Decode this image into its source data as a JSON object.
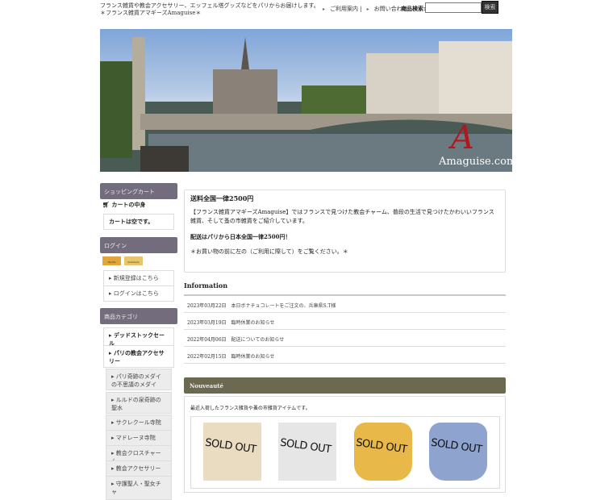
{
  "header": {
    "tagline": "フランス雑貨や教会アクセサリー、エッフェル塔グッズなどをパリからお届けします。",
    "shop_name": "＊フランス雑貨アマギーズAmaguise＊",
    "links": [
      "ご利用案内 |",
      "お問い合わせ"
    ],
    "search_label": "商品検索:",
    "search_value": "",
    "search_button": "検索"
  },
  "banner": {
    "logo_text": "Amaguise.com"
  },
  "sidebar": {
    "cart": {
      "title": "ショッピングカート",
      "contents_label": "カートの中身",
      "empty_text": "カートは空です。"
    },
    "login": {
      "title": "ログイン",
      "badges": [
        "PayPal",
        "members"
      ],
      "register": "新規登録はこちら",
      "login": "ログインはこちら"
    },
    "categories": {
      "title": "商品カテゴリ",
      "items": [
        "デッドストックセール",
        "パリの教会アクセサリー"
      ],
      "subitems": [
        "パリ奇跡のメダイの不思議のメダイ",
        "ルルドの泉奇跡の聖水",
        "サクレクール寺院",
        "マドレーヌ寺院",
        "教会クロスチャーム",
        "教会アクセサリー",
        "守護聖人・聖女チャ"
      ]
    }
  },
  "main": {
    "notice": {
      "title": "送料全国一律2500円",
      "body": "【フランス雑貨アマギーズAmaguise】ではフランスで見つけた教会チャーム、普段の生活で見つけたかわいいフランス雑貨、そして蚤の市雑貨をご紹介しています。",
      "shipping": "配送はパリから日本全国一律2500円！",
      "note": "＊お買い物の前に左の（ご利用に際して）をご覧ください。＊"
    },
    "information": {
      "title": "Information",
      "rows": [
        {
          "date": "2023年03月22日",
          "text": "本日ボナチョコレートをご注文の、兵庫県S.T様"
        },
        {
          "date": "2023年03月19日",
          "text": "臨時休業のお知らせ"
        },
        {
          "date": "2022年04月06日",
          "text": "配送についてのお知らせ"
        },
        {
          "date": "2022年02月15日",
          "text": "臨時休業のお知らせ"
        }
      ]
    },
    "nouveaute": {
      "title": "Nouveauté",
      "desc": "最近入荷したフランス雑貨や蚤の市雑貨アイテムです。",
      "items": [
        {
          "label": "SOLD OUT",
          "color": "#e9dcc0"
        },
        {
          "label": "SOLD OUT",
          "color": "#e2e2e2"
        },
        {
          "label": "SOLD OUT",
          "color": "#e8b948"
        },
        {
          "label": "SOLD OUT",
          "color": "#8ea4cf"
        }
      ]
    }
  }
}
